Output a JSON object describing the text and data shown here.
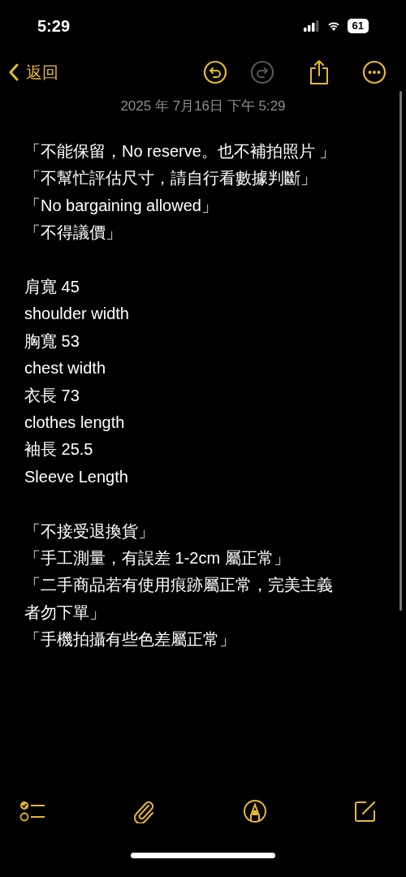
{
  "status_bar": {
    "time": "5:29",
    "battery": "61"
  },
  "nav": {
    "back_label": "返回",
    "undo": {
      "disabled": false
    },
    "redo": {
      "disabled": true
    }
  },
  "note": {
    "date": "2025 年 7月16日 下午 5:29",
    "paragraphs": [
      [
        "「不能保留，No reserve。也不補拍照片 」",
        "「不幫忙評估尺寸，請自行看數據判斷」",
        "「No bargaining allowed」",
        "「不得議價」"
      ],
      [
        "肩寬 45",
        "shoulder width",
        "胸寬 53",
        "chest width",
        "衣長 73",
        "clothes length",
        "袖長 25.5",
        "Sleeve Length"
      ],
      [
        "「不接受退換貨」",
        "「手工測量，有誤差 1-2cm 屬正常」",
        "「二手商品若有使用痕跡屬正常，完美主義者勿下單」",
        "「手機拍攝有些色差屬正常」"
      ]
    ]
  }
}
